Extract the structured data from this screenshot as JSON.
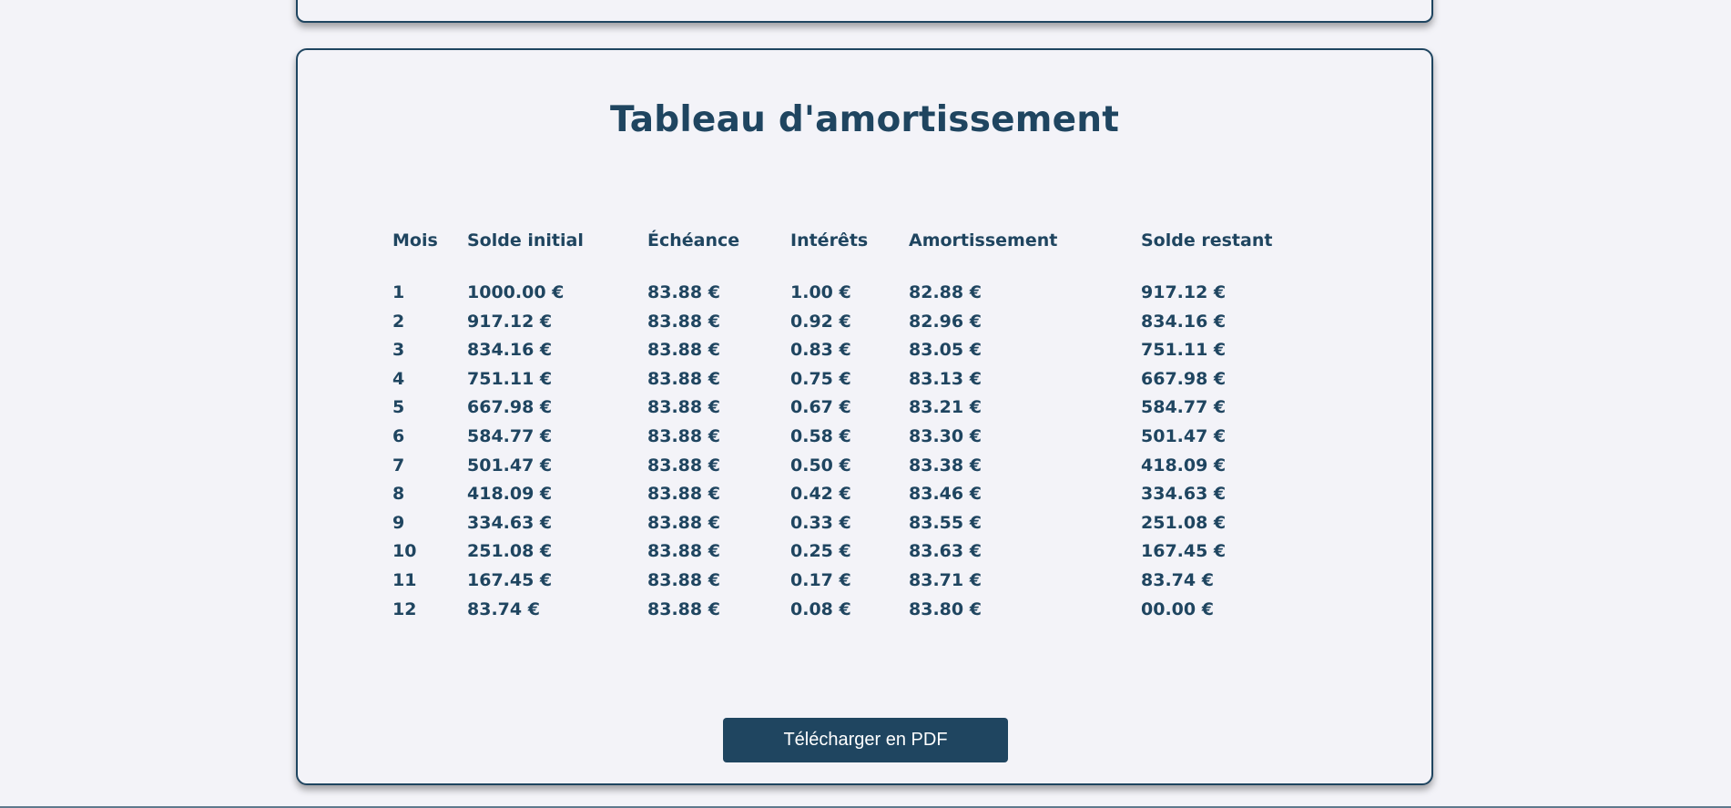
{
  "colors": {
    "background": "#f3f3f8",
    "primary": "#1f4560",
    "button_text": "#ffffff"
  },
  "card": {
    "title": "Tableau d'amortissement"
  },
  "table": {
    "headers": [
      "Mois",
      "Solde initial",
      "Échéance",
      "Intérêts",
      "Amortissement",
      "Solde restant"
    ],
    "rows": [
      [
        "1",
        "1000.00 €",
        "83.88 €",
        "1.00 €",
        "82.88 €",
        "917.12 €"
      ],
      [
        "2",
        "917.12 €",
        "83.88 €",
        "0.92 €",
        "82.96 €",
        "834.16 €"
      ],
      [
        "3",
        "834.16 €",
        "83.88 €",
        "0.83 €",
        "83.05 €",
        "751.11 €"
      ],
      [
        "4",
        "751.11 €",
        "83.88 €",
        "0.75 €",
        "83.13 €",
        "667.98 €"
      ],
      [
        "5",
        "667.98 €",
        "83.88 €",
        "0.67 €",
        "83.21 €",
        "584.77 €"
      ],
      [
        "6",
        "584.77 €",
        "83.88 €",
        "0.58 €",
        "83.30 €",
        "501.47 €"
      ],
      [
        "7",
        "501.47 €",
        "83.88 €",
        "0.50 €",
        "83.38 €",
        "418.09 €"
      ],
      [
        "8",
        "418.09 €",
        "83.88 €",
        "0.42 €",
        "83.46 €",
        "334.63 €"
      ],
      [
        "9",
        "334.63 €",
        "83.88 €",
        "0.33 €",
        "83.55 €",
        "251.08 €"
      ],
      [
        "10",
        "251.08 €",
        "83.88 €",
        "0.25 €",
        "83.63 €",
        "167.45 €"
      ],
      [
        "11",
        "167.45 €",
        "83.88 €",
        "0.17 €",
        "83.71 €",
        "83.74 €"
      ],
      [
        "12",
        "83.74 €",
        "83.88 €",
        "0.08 €",
        "83.80 €",
        "00.00 €"
      ]
    ]
  },
  "actions": {
    "download_pdf_label": "Télécharger en PDF"
  }
}
